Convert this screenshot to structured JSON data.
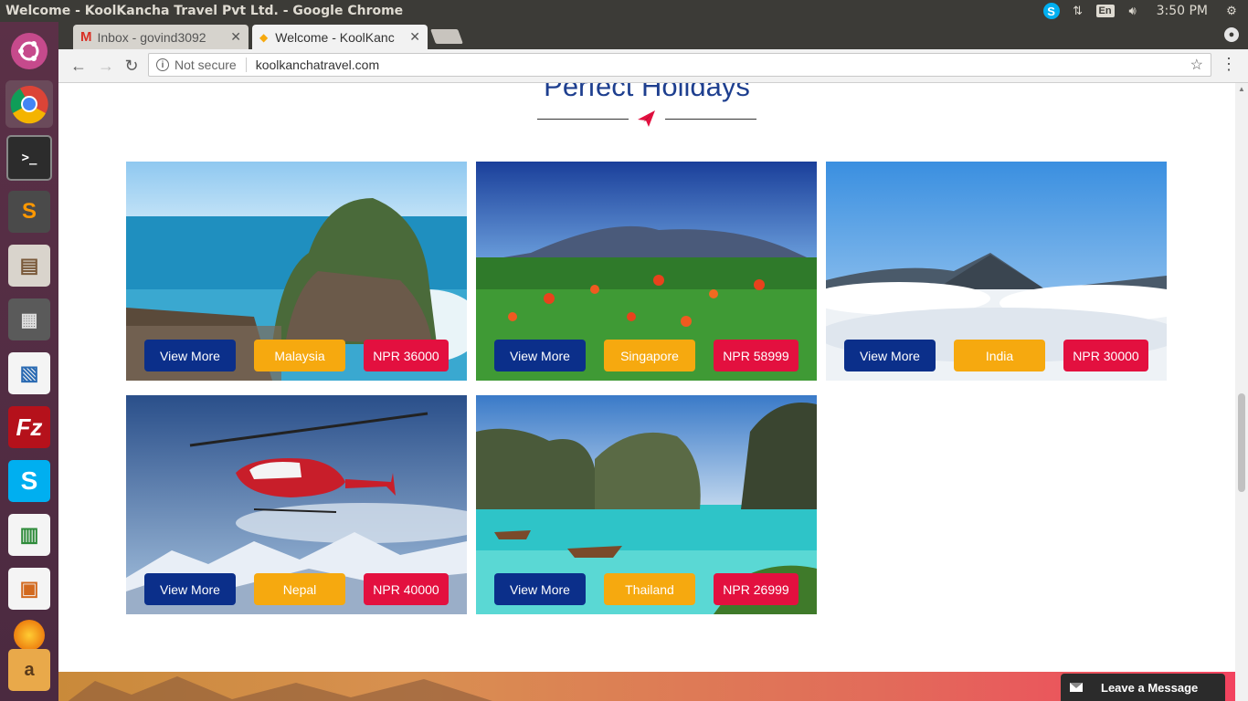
{
  "os": {
    "window_title": "Welcome - KoolKancha Travel Pvt Ltd. - Google Chrome",
    "clock": "3:50 PM",
    "language": "En"
  },
  "browser": {
    "tabs": [
      {
        "label": "Inbox - govind3092",
        "active": false
      },
      {
        "label": "Welcome - KoolKanc",
        "active": true
      }
    ],
    "security_label": "Not secure",
    "url": "koolkanchatravel.com"
  },
  "page": {
    "section_title": "Perfect Holidays",
    "packages": [
      {
        "view_label": "View More",
        "country": "Malaysia",
        "price": "NPR 36000"
      },
      {
        "view_label": "View More",
        "country": "Singapore",
        "price": "NPR 58999"
      },
      {
        "view_label": "View More",
        "country": "India",
        "price": "NPR 30000"
      },
      {
        "view_label": "View More",
        "country": "Nepal",
        "price": "NPR 40000"
      },
      {
        "view_label": "View More",
        "country": "Thailand",
        "price": "NPR 26999"
      }
    ],
    "chat_widget_label": "Leave a Message"
  },
  "colors": {
    "view_button": "#0b2f8a",
    "country_button": "#f6a90f",
    "price_button": "#e3103f",
    "title_color": "#1e3f8f"
  }
}
